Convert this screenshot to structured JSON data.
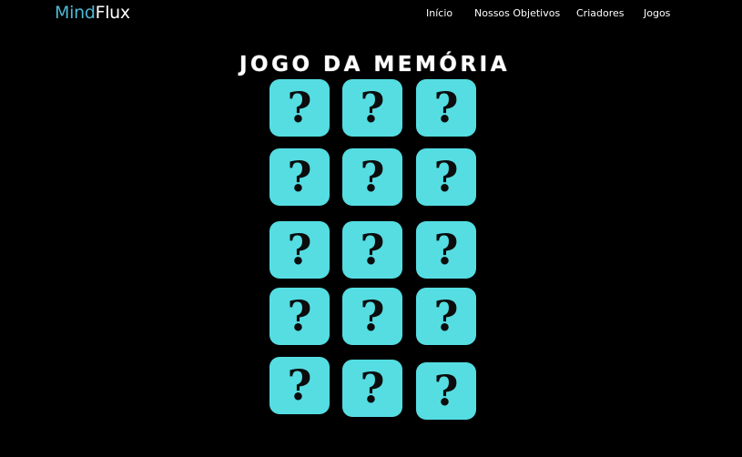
{
  "header": {
    "brand_part1": "Mind",
    "brand_part2": "Flux",
    "nav": [
      {
        "label": "Início"
      },
      {
        "label": "Nossos Objetivos"
      },
      {
        "label": "Criadores"
      },
      {
        "label": "Jogos"
      }
    ]
  },
  "game": {
    "title": "JOGO DA MEMÓRIA",
    "card_back_symbol": "?",
    "card_count": 15
  },
  "colors": {
    "background": "#000000",
    "brand_accent": "#4fb8d4",
    "card_face": "#55dde2",
    "text": "#ffffff"
  }
}
